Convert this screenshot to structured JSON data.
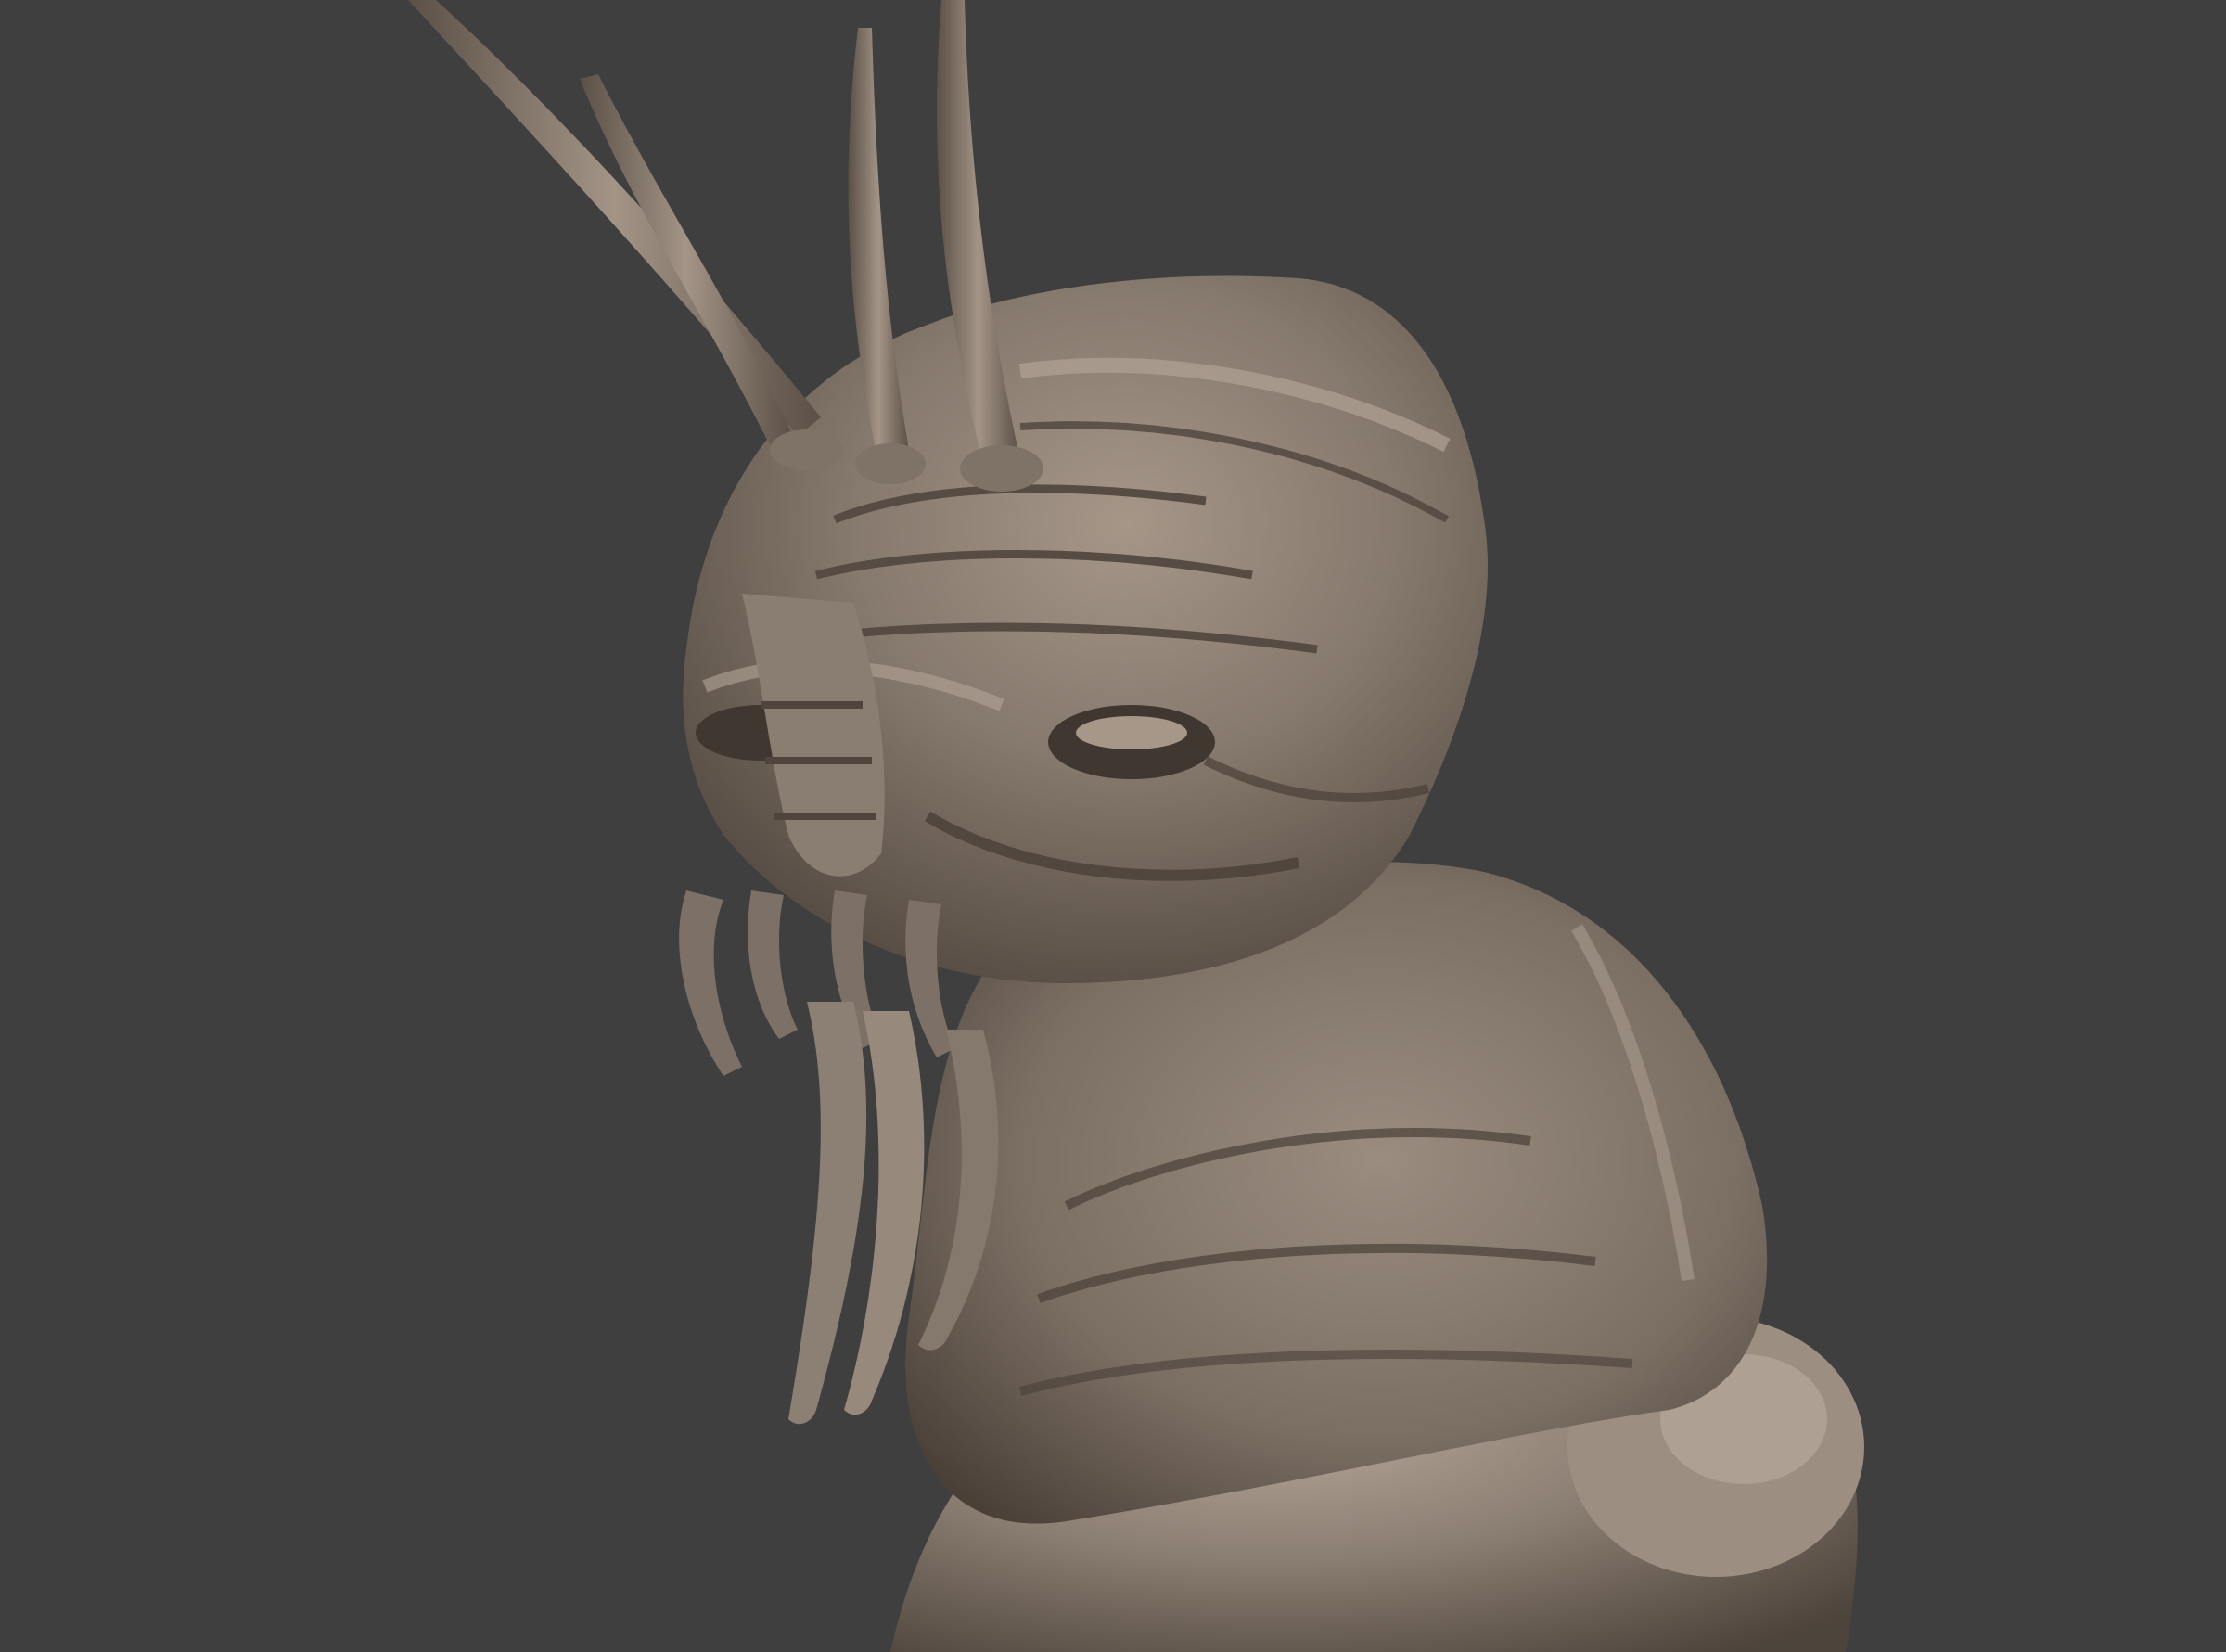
{
  "scene": {
    "background_color": "#3f3f3f",
    "material_color": "#86796d",
    "highlight_color": "#b3a597",
    "shadow_color": "#4a4038",
    "subject": "creature-bust-sculpt"
  }
}
